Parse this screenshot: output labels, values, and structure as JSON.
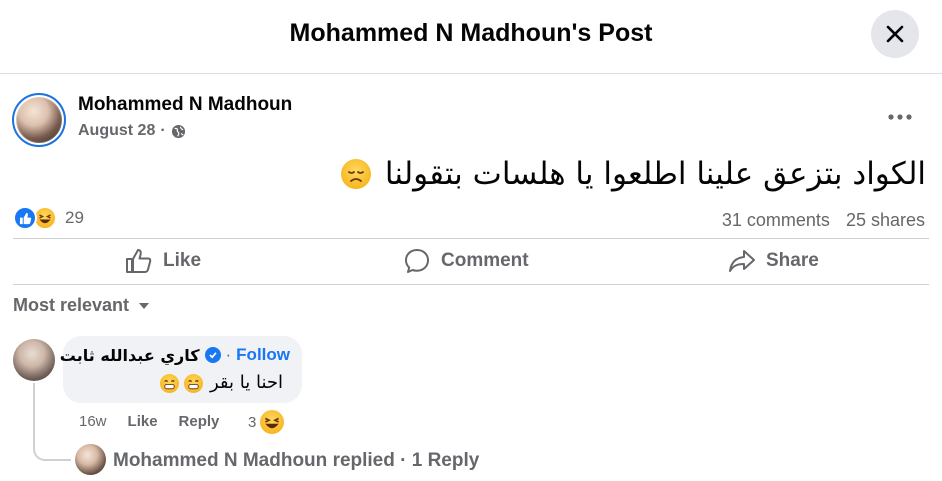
{
  "header": {
    "title": "Mohammed N Madhoun's Post"
  },
  "post": {
    "author": "Mohammed N Madhoun",
    "date": "August 28",
    "separator": "·",
    "text": "الكواد بتزعق علينا اطلعوا يا هلسات بتقولنا",
    "text_emoji": "disappointed-face-emoji"
  },
  "stats": {
    "reactions_count": "29",
    "comments": "31 comments",
    "shares": "25 shares"
  },
  "actions": {
    "like": "Like",
    "comment": "Comment",
    "share": "Share"
  },
  "sort": {
    "label": "Most relevant"
  },
  "comment": {
    "author": "كاري عبدالله ثابت",
    "separator": "·",
    "follow": "Follow",
    "text": "احنا يا بقر",
    "time": "16w",
    "like": "Like",
    "reply": "Reply",
    "reaction_count": "3"
  },
  "reply_summary": {
    "author": "Mohammed N Madhoun",
    "text": "replied · 1 Reply"
  },
  "colors": {
    "accent": "#1877f2",
    "muted": "#65676b",
    "bubble": "#f0f2f5"
  }
}
